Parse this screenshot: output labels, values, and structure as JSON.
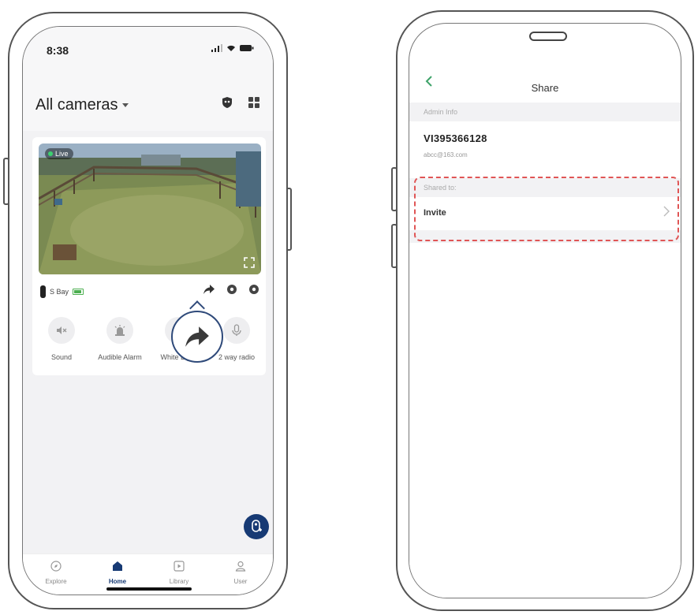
{
  "left_phone": {
    "status": {
      "time": "8:38"
    },
    "header": {
      "title": "All cameras"
    },
    "camera": {
      "live_badge": "Live",
      "name": "S Bay"
    },
    "controls": [
      {
        "label": "Sound",
        "icon": "speaker-muted-icon"
      },
      {
        "label": "Audible Alarm",
        "icon": "siren-icon"
      },
      {
        "label": "White Light",
        "icon": "share-arrow-icon"
      },
      {
        "label": "2 way radio",
        "icon": "microphone-icon"
      }
    ],
    "tabs": [
      {
        "label": "Explore",
        "icon": "compass-icon"
      },
      {
        "label": "Home",
        "icon": "home-icon",
        "active": true
      },
      {
        "label": "Library",
        "icon": "play-square-icon"
      },
      {
        "label": "User",
        "icon": "user-icon"
      }
    ]
  },
  "right_phone": {
    "header": {
      "title": "Share"
    },
    "admin_section": {
      "heading": "Admin Info",
      "id": "VI395366128",
      "email": "abcc@163.com"
    },
    "shared_section": {
      "heading": "Shared to:",
      "invite_label": "Invite"
    }
  },
  "colors": {
    "accent": "#173a74",
    "live_green": "#3cd070",
    "highlight_red": "#e05555",
    "back_green": "#3fa36a"
  }
}
